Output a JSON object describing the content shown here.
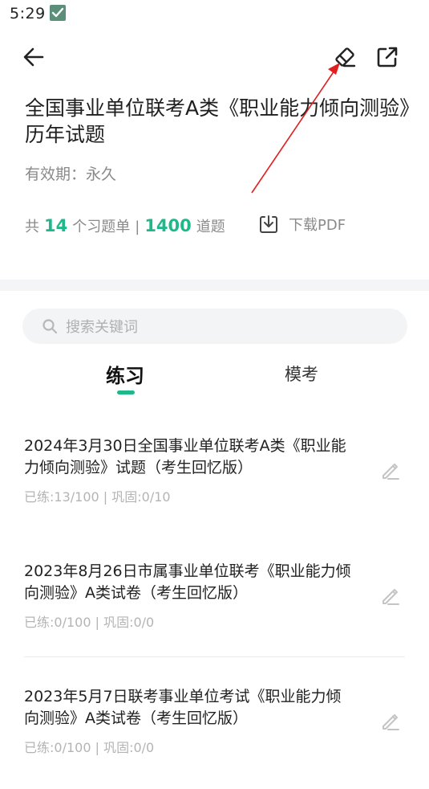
{
  "status_bar": {
    "time": "5:29"
  },
  "header": {
    "title": "全国事业单位联考A类《职业能力倾向测验》历年试题",
    "validity": "有效期：永久"
  },
  "stats": {
    "prefix": "共",
    "sheet_count": "14",
    "sheet_unit": "个习题单",
    "separator": "|",
    "question_count": "1400",
    "question_unit": "道题"
  },
  "download": {
    "label": "下载PDF"
  },
  "search": {
    "placeholder": "搜索关键词"
  },
  "tabs": [
    {
      "label": "练习",
      "active": true
    },
    {
      "label": "模考",
      "active": false
    }
  ],
  "items": [
    {
      "title": "2024年3月30日全国事业单位联考A类《职业能力倾向测验》试题（考生回忆版）",
      "meta": "已练:13/100 | 巩固:0/10"
    },
    {
      "title": "2023年8月26日市属事业单位联考《职业能力倾向测验》A类试卷（考生回忆版）",
      "meta": "已练:0/100 | 巩固:0/0"
    },
    {
      "title": "2023年5月7日联考事业单位考试《职业能力倾向测验》A类试卷（考生回忆版）",
      "meta": "已练:0/100 | 巩固:0/0"
    }
  ],
  "colors": {
    "accent": "#1fb88a",
    "annotation_arrow": "#e02020"
  },
  "icons": {
    "back": "arrow-left-icon",
    "erase": "eraser-icon",
    "share": "share-external-icon",
    "download": "download-icon",
    "search": "search-icon",
    "edit": "pencil-icon"
  }
}
